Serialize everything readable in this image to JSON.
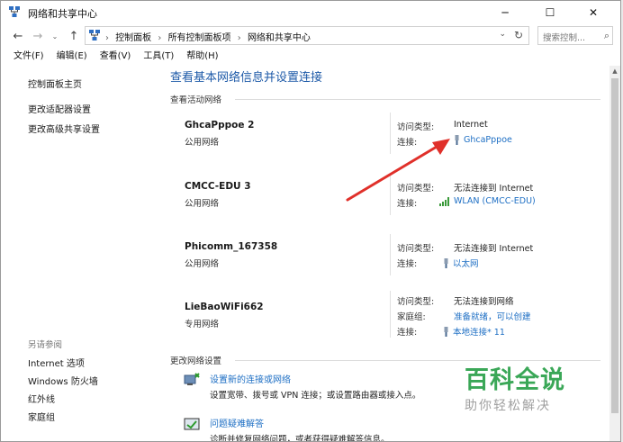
{
  "window": {
    "title": "网络和共享中心"
  },
  "controls": {
    "minimize": "─",
    "maximize": "☐",
    "close": "✕"
  },
  "nav": {
    "back": "←",
    "forward": "→",
    "recent": "⌄",
    "up": "↑",
    "breadcrumbs": [
      "控制面板",
      "所有控制面板项",
      "网络和共享中心"
    ],
    "separator": "›",
    "dropdown": "⌄",
    "refresh": "↻",
    "search_placeholder": "搜索控制...",
    "search_icon": "⌕"
  },
  "menu": [
    "文件(F)",
    "编辑(E)",
    "查看(V)",
    "工具(T)",
    "帮助(H)"
  ],
  "sidebar": {
    "links": [
      "控制面板主页",
      "更改适配器设置",
      "更改高级共享设置"
    ],
    "see_also_heading": "另请参阅",
    "see_also": [
      "Internet 选项",
      "Windows 防火墙",
      "红外线",
      "家庭组"
    ]
  },
  "main": {
    "title": "查看基本网络信息并设置连接",
    "active_heading": "查看活动网络",
    "labels": {
      "access": "访问类型:",
      "connection": "连接:",
      "homegroup": "家庭组:"
    },
    "networks": [
      {
        "name": "GhcaPppoe  2",
        "type": "公用网络",
        "access": "Internet",
        "connection": "GhcaPppoe",
        "conn_icon": "cable-icon"
      },
      {
        "name": "CMCC-EDU  3",
        "type": "公用网络",
        "access": "无法连接到 Internet",
        "connection": "WLAN (CMCC-EDU)",
        "conn_icon": "wifi-signal-icon"
      },
      {
        "name": "Phicomm_167358",
        "type": "公用网络",
        "access": "无法连接到 Internet",
        "connection": "以太网",
        "conn_icon": "cable-icon"
      },
      {
        "name": "LieBaoWiFi662",
        "type": "专用网络",
        "access": "无法连接到网络",
        "homegroup": "准备就绪，可以创建",
        "connection": "本地连接* 11",
        "conn_icon": "cable-icon"
      }
    ],
    "change_heading": "更改网络设置",
    "tasks": [
      {
        "link": "设置新的连接或网络",
        "desc": "设置宽带、拨号或 VPN 连接；或设置路由器或接入点。",
        "icon": "new-connection-icon"
      },
      {
        "link": "问题疑难解答",
        "desc": "诊断并修复网络问题，或者获得疑难解答信息。",
        "icon": "troubleshoot-icon"
      }
    ]
  },
  "watermark": {
    "main": "百科全说",
    "sub": "助你轻松解决"
  },
  "colors": {
    "link": "#1e6fc4",
    "title": "#1e5aa8",
    "arrow": "#e0302a",
    "watermark": "#3aa757"
  }
}
